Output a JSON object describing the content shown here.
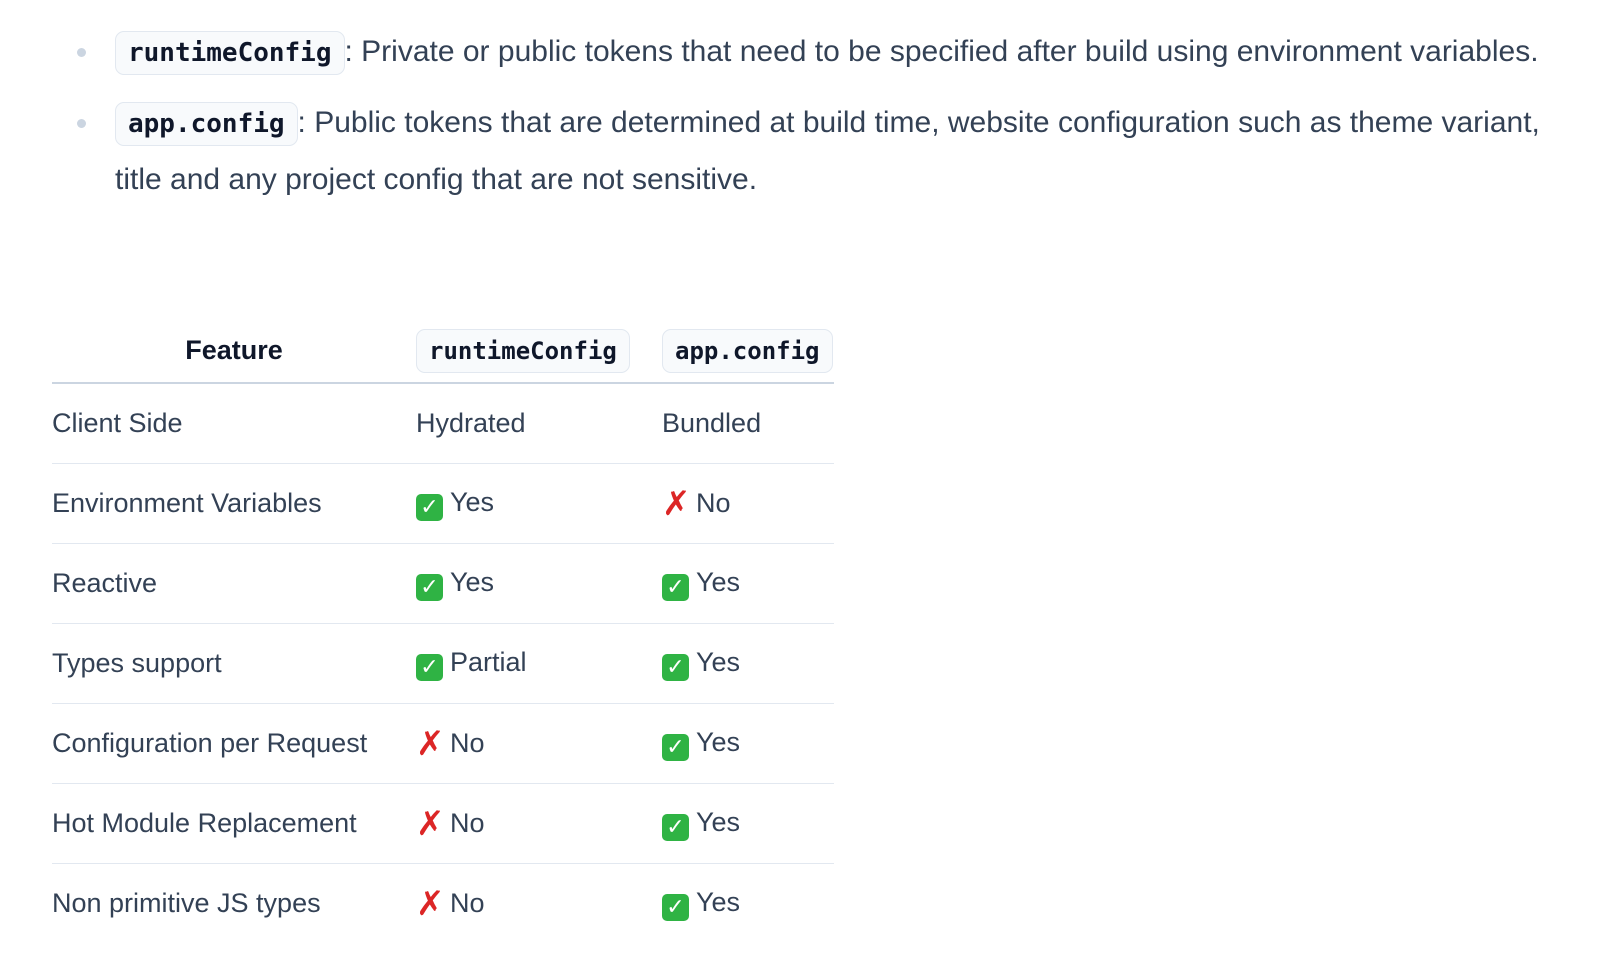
{
  "bullets": [
    {
      "code": "runtimeConfig",
      "text": ": Private or public tokens that need to be specified after build using environment variables."
    },
    {
      "code": "app.config",
      "text": ": Public tokens that are determined at build time, website configuration such as theme variant, title and any project config that are not sensitive."
    }
  ],
  "table": {
    "headers": [
      "Feature",
      "runtimeConfig",
      "app.config"
    ],
    "rows": [
      {
        "feature": "Client Side",
        "runtime": {
          "mark": "",
          "mark_icon": "",
          "text": "Hydrated"
        },
        "app": {
          "mark": "",
          "mark_icon": "",
          "text": "Bundled"
        }
      },
      {
        "feature": "Environment Variables",
        "runtime": {
          "mark": "✓",
          "mark_icon": "check-mark-icon",
          "text": "Yes"
        },
        "app": {
          "mark": "✗",
          "mark_icon": "cross-mark-icon",
          "text": "No"
        }
      },
      {
        "feature": "Reactive",
        "runtime": {
          "mark": "✓",
          "mark_icon": "check-mark-icon",
          "text": "Yes"
        },
        "app": {
          "mark": "✓",
          "mark_icon": "check-mark-icon",
          "text": "Yes"
        }
      },
      {
        "feature": "Types support",
        "runtime": {
          "mark": "✓",
          "mark_icon": "check-mark-icon",
          "text": "Partial"
        },
        "app": {
          "mark": "✓",
          "mark_icon": "check-mark-icon",
          "text": "Yes"
        }
      },
      {
        "feature": "Configuration per Request",
        "runtime": {
          "mark": "✗",
          "mark_icon": "cross-mark-icon",
          "text": "No"
        },
        "app": {
          "mark": "✓",
          "mark_icon": "check-mark-icon",
          "text": "Yes"
        }
      },
      {
        "feature": "Hot Module Replacement",
        "runtime": {
          "mark": "✗",
          "mark_icon": "cross-mark-icon",
          "text": "No"
        },
        "app": {
          "mark": "✓",
          "mark_icon": "check-mark-icon",
          "text": "Yes"
        }
      },
      {
        "feature": "Non primitive JS types",
        "runtime": {
          "mark": "✗",
          "mark_icon": "cross-mark-icon",
          "text": "No"
        },
        "app": {
          "mark": "✓",
          "mark_icon": "check-mark-icon",
          "text": "Yes"
        }
      }
    ]
  },
  "colors": {
    "text": "#334155",
    "heading": "#0f172a",
    "check_bg": "#2fb344",
    "cross": "#dc2626",
    "border": "#e2e8f0",
    "code_bg": "#f8fafc"
  }
}
